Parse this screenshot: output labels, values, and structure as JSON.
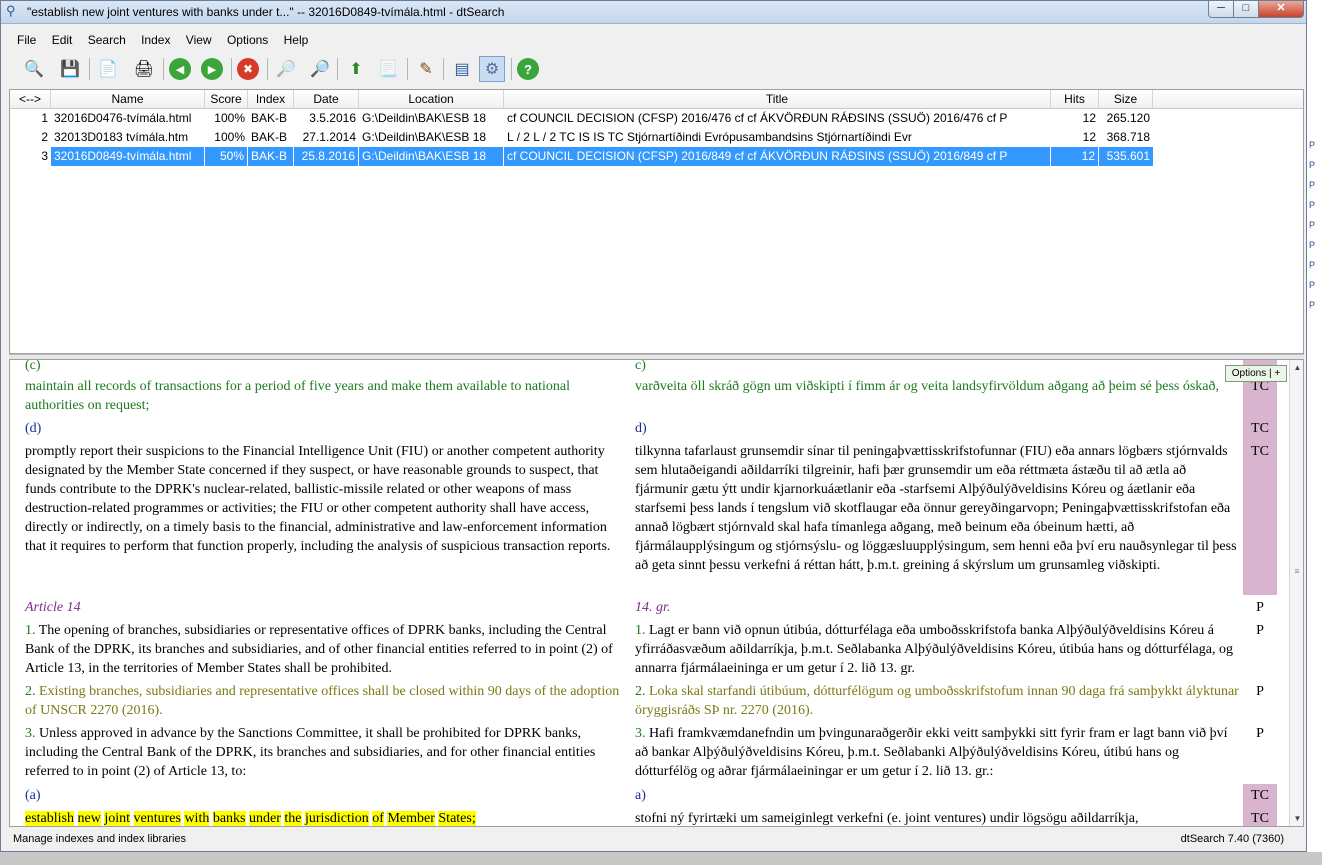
{
  "window": {
    "title": "\"establish new joint ventures with banks under t...\" -- 32016D0849-tvímála.html - dtSearch",
    "min_label": "─",
    "max_label": "□",
    "close_label": "✕"
  },
  "menu": [
    "File",
    "Edit",
    "Search",
    "Index",
    "View",
    "Options",
    "Help"
  ],
  "toolbar_icons": [
    {
      "name": "search-icon",
      "glyph": "🔍"
    },
    {
      "name": "save-icon",
      "glyph": "💾"
    },
    {
      "name": "copy-icon",
      "glyph": "📄"
    },
    {
      "name": "print-icon",
      "glyph": "🖨"
    },
    {
      "name": "back-icon",
      "glyph": "◀"
    },
    {
      "name": "forward-icon",
      "glyph": "▶"
    },
    {
      "name": "stop-icon",
      "glyph": "✖"
    },
    {
      "name": "find-prev-icon",
      "glyph": "🔎"
    },
    {
      "name": "find-next-icon",
      "glyph": "🔎"
    },
    {
      "name": "export-icon",
      "glyph": "⬆"
    },
    {
      "name": "doc-icon",
      "glyph": "📃"
    },
    {
      "name": "edit-icon",
      "glyph": "✎"
    },
    {
      "name": "index-icon",
      "glyph": "▤"
    },
    {
      "name": "manage-index-icon",
      "glyph": "⚙"
    },
    {
      "name": "help-icon",
      "glyph": "?"
    }
  ],
  "grid": {
    "headers": [
      "<-->",
      "Name",
      "Score",
      "Index",
      "Date",
      "Location",
      "Title",
      "Hits",
      "Size"
    ],
    "rows": [
      [
        "1",
        "32016D0476-tvímála.html",
        "100%",
        "BAK-B",
        "3.5.2016",
        "G:\\Deildin\\BAK\\ESB 18",
        "cf COUNCIL DECISION (CFSP) 2016/476 cf cf ÁKVÖRÐUN RÁÐSINS (SSUÖ) 2016/476 cf P",
        "12",
        "265.120"
      ],
      [
        "2",
        "32013D0183 tvímála.htm",
        "100%",
        "BAK-B",
        "27.1.2014",
        "G:\\Deildin\\BAK\\ESB 18",
        "L / 2 L / 2 TC  IS IS TC  Stjórnartíðindi Evrópusambandsins Stjórnartíðindi Evr",
        "12",
        "368.718"
      ],
      [
        "3",
        "32016D0849-tvímála.html",
        "50%",
        "BAK-B",
        "25.8.2016",
        "G:\\Deildin\\BAK\\ESB 18",
        "cf COUNCIL DECISION (CFSP) 2016/849 cf cf ÁKVÖRÐUN RÁÐSINS (SSUÖ) 2016/849 cf P",
        "12",
        "535.601"
      ]
    ],
    "selected_row": 3
  },
  "doc": {
    "options_label": "Options | +",
    "c_en": "(c)",
    "c_is": "c)",
    "p1_en": "maintain all records of transactions for a period of five years and make them available to national authorities on request;",
    "p1_is": "varðveita öll skráð gögn um viðskipti í fimm ár og veita landsyfirvöldum aðgang að þeim sé þess óskað,",
    "d_en": "(d)",
    "d_is": "d)",
    "p2_en": "promptly report their suspicions to the Financial Intelligence Unit (FIU) or another competent authority designated by the Member State concerned if they suspect, or have reasonable grounds to suspect, that funds contribute to the DPRK's nuclear-related, ballistic-missile related or other weapons of mass destruction-related programmes or activities; the FIU or other competent authority shall have access, directly or indirectly, on a timely basis to the financial, administrative and law-enforcement information that it requires to perform that function properly, including the analysis of suspicious transaction reports.",
    "p2_is": "tilkynna tafarlaust grunsemdir sínar til peningaþvættisskrifstofunnar (FIU) eða annars lögbærs stjórnvalds sem hlutaðeigandi aðildarríki tilgreinir, hafi þær grunsemdir um eða réttmæta ástæðu til að ætla að fjármunir gætu ýtt undir kjarnorkuáætlanir eða -starfsemi Alþýðulýðveldisins Kóreu og áætlanir eða starfsemi þess lands í tengslum við skotflaugar eða önnur gereyðingarvopn; Peningaþvættisskrifstofan eða annað lögbært stjórnvald skal hafa tímanlega aðgang, með beinum eða óbeinum hætti, að fjármálaupplýsingum og stjórnsýslu- og löggæsluupplýsingum, sem henni eða því eru nauðsynlegar til þess að geta sinnt þessu verkefni á réttan hátt, þ.m.t. greining á skýrslum um grunsamleg viðskipti.",
    "art_en": "Article 14",
    "art_is": "14. gr.",
    "s1_num": "1.",
    "s1_en": " The opening of branches, subsidiaries or representative offices of DPRK banks, including the Central Bank of the DPRK, its branches and subsidiaries, and of other financial entities referred to in point (2) of Article 13, in the territories of Member States shall be prohibited.",
    "s1_is": " Lagt er bann við opnun útibúa, dótturfélaga eða umboðsskrifstofa banka Alþýðulýðveldisins Kóreu á yfirráðasvæðum aðildarríkja, þ.m.t. Seðlabanka Alþýðulýðveldisins Kóreu, útibúa hans og dótturfélaga, og annarra fjármálaeininga er um getur í 2. lið 13. gr.",
    "s2_num": "2.",
    "s2_en": " Existing branches, subsidiaries and representative offices shall be closed within 90 days of the adoption of UNSCR 2270 (2016).",
    "s2_is": " Loka skal starfandi útibúum, dótturfélögum og umboðsskrifstofum innan 90 daga frá samþykkt ályktunar öryggisráðs SÞ nr. 2270 (2016).",
    "s3_num": "3.",
    "s3_en": " Unless approved in advance by the Sanctions Committee, it shall be prohibited for DPRK banks, including the Central Bank of the DPRK, its branches and subsidiaries, and for other financial entities referred to in point (2) of Article 13, to:",
    "s3_is": " Hafi framkvæmdanefndin um þvingunaraðgerðir ekki veitt samþykki sitt fyrir fram er lagt bann við því að bankar Alþýðulýðveldisins Kóreu, þ.m.t. Seðlabanki Alþýðulýðveldisins Kóreu, útibú hans og dótturfélög og aðrar fjármálaeiningar er um getur í 2. lið 13. gr.:",
    "a_en": "(a)",
    "a_is": "a)",
    "last_en_words": [
      "establish",
      "new",
      "joint",
      "ventures",
      "with",
      "banks",
      "under",
      "the",
      "jurisdiction",
      "of",
      "Member",
      "States;"
    ],
    "last_is": "stofni ný fyrirtæki um sameiginlegt verkefni (e. joint ventures) undir lögsögu aðildarríkja,",
    "marks": {
      "tc": "TC",
      "p": "P"
    }
  },
  "status": {
    "left": "Manage indexes and index libraries",
    "right": "dtSearch 7.40 (7360)"
  }
}
